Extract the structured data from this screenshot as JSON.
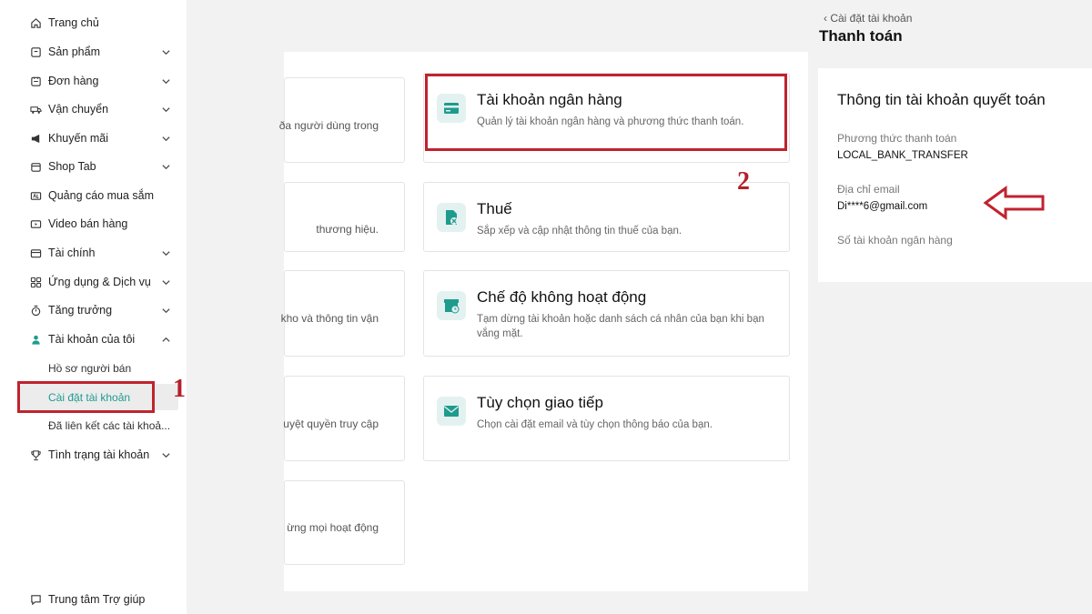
{
  "sidebar": {
    "items": [
      {
        "label": "Trang chủ",
        "icon": "home-icon"
      },
      {
        "label": "Sản phẩm",
        "icon": "product-box-icon"
      },
      {
        "label": "Đơn hàng",
        "icon": "orders-icon"
      },
      {
        "label": "Vận chuyển",
        "icon": "truck-icon"
      },
      {
        "label": "Khuyến mãi",
        "icon": "megaphone-icon"
      },
      {
        "label": "Shop Tab",
        "icon": "shop-tab-icon"
      },
      {
        "label": "Quảng cáo mua sắm",
        "icon": "ad-icon"
      },
      {
        "label": "Video bán hàng",
        "icon": "video-icon"
      },
      {
        "label": "Tài chính",
        "icon": "wallet-icon"
      },
      {
        "label": "Ứng dụng & Dịch vụ",
        "icon": "apps-icon"
      },
      {
        "label": "Tăng trưởng",
        "icon": "growth-icon"
      },
      {
        "label": "Tài khoản của tôi",
        "icon": "user-icon"
      }
    ],
    "sub_items": [
      {
        "label": "Hồ sơ người bán"
      },
      {
        "label": "Cài đặt tài khoản"
      },
      {
        "label": "Đã liên kết các tài khoả..."
      }
    ],
    "status_item": {
      "label": "Tình trạng tài khoản",
      "icon": "trophy-icon"
    },
    "help": {
      "label": "Trung tâm Trợ giúp",
      "icon": "help-chat-icon"
    }
  },
  "annotations": {
    "step1": "1",
    "step2": "2"
  },
  "left_cards": [
    {
      "desc": "ða người dùng trong"
    },
    {
      "desc": "thương hiệu."
    },
    {
      "desc": "kho và thông tin vận"
    },
    {
      "desc": "uyệt quyền truy cập"
    },
    {
      "desc": "ừng mọi hoạt động"
    }
  ],
  "right_cards": [
    {
      "title": "Tài khoản ngân hàng",
      "desc": "Quản lý tài khoản ngân hàng và phương thức thanh toán.",
      "icon": "bank-card-icon"
    },
    {
      "title": "Thuế",
      "desc": "Sắp xếp và cập nhật thông tin thuế của bạn.",
      "icon": "tax-document-icon"
    },
    {
      "title": "Chế độ không hoạt động",
      "desc": "Tạm dừng tài khoản hoặc danh sách cá nhân của bạn khi bạn vắng mặt.",
      "icon": "store-clock-icon"
    },
    {
      "title": "Tùy chọn giao tiếp",
      "desc": "Chọn cài đặt email và tùy chọn thông báo của bạn.",
      "icon": "envelope-icon"
    }
  ],
  "header": {
    "back_label": "Cài đặt tài khoản",
    "title": "Thanh toán"
  },
  "settlement": {
    "title": "Thông tin tài khoản quyết toán",
    "method_label": "Phương thức thanh toán",
    "method_value": "LOCAL_BANK_TRANSFER",
    "email_label": "Địa chỉ email",
    "email_value": "Di****6@gmail.com",
    "bank_label": "Số tài khoản ngân hàng"
  },
  "colors": {
    "accent": "#1f9b8e",
    "annotation_red": "#c0232e"
  }
}
